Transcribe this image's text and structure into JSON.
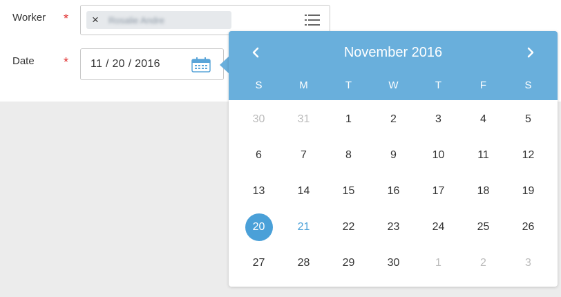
{
  "form": {
    "worker_label": "Worker",
    "worker_required_mark": "*",
    "worker_pill_remove": "×",
    "worker_value": "Rosalie Andre",
    "date_label": "Date",
    "date_required_mark": "*",
    "date_value": "11 / 20 / 2016"
  },
  "calendar": {
    "title": "November 2016",
    "prev_icon": "chevron-left-icon",
    "next_icon": "chevron-right-icon",
    "weekdays": [
      "S",
      "M",
      "T",
      "W",
      "T",
      "F",
      "S"
    ],
    "weeks": [
      [
        "30",
        "31",
        "1",
        "2",
        "3",
        "4",
        "5"
      ],
      [
        "6",
        "7",
        "8",
        "9",
        "10",
        "11",
        "12"
      ],
      [
        "13",
        "14",
        "15",
        "16",
        "17",
        "18",
        "19"
      ],
      [
        "20",
        "21",
        "22",
        "23",
        "24",
        "25",
        "26"
      ],
      [
        "27",
        "28",
        "29",
        "30",
        "1",
        "2",
        "3"
      ]
    ],
    "selected_day": "20",
    "today_day": "21"
  },
  "colors": {
    "header_bg": "#69afdc",
    "selected_bg": "#4aa0d8",
    "required": "#e02d2d",
    "muted_day": "#bbbbbb"
  }
}
